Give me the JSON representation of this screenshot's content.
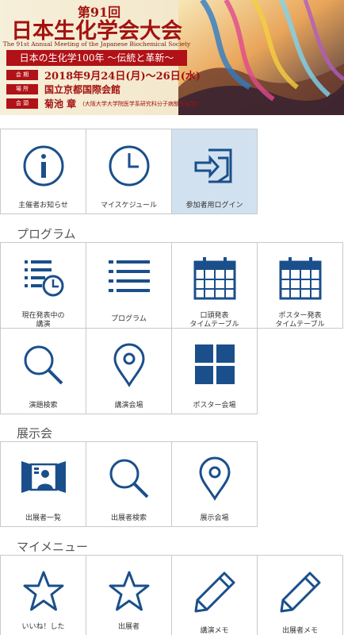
{
  "banner": {
    "edition": "第91回",
    "title": "日本生化学会大会",
    "subtitle_en": "The 91st Annual Meeting of the Japanese Biochemical Society",
    "theme": "日本の生化学100年 〜伝統と革新〜",
    "period_label": "会 期",
    "period_value": "2018年9月24日(月)〜26日(水)",
    "venue_label": "場 所",
    "venue_value": "国立京都国際会館",
    "chair_label": "会 頭",
    "chair_value": "菊池 章",
    "chair_note": "(大阪大学大学院医学系研究科分子病態生化学)"
  },
  "top_menu": [
    {
      "label": "主催者お知らせ",
      "icon": "info-icon"
    },
    {
      "label": "マイスケジュール",
      "icon": "clock-icon"
    },
    {
      "label": "参加者用ログイン",
      "icon": "login-icon"
    }
  ],
  "sections": {
    "program": "プログラム",
    "exhibition": "展示会",
    "mymenu": "マイメニュー"
  },
  "program_menu": [
    {
      "label": "現在発表中の\n講演",
      "icon": "current-list-clock-icon"
    },
    {
      "label": "プログラム",
      "icon": "list-icon"
    },
    {
      "label": "口頭発表\nタイムテーブル",
      "icon": "calendar-icon"
    },
    {
      "label": "ポスター発表\nタイムテーブル",
      "icon": "calendar-icon"
    },
    {
      "label": "演題検索",
      "icon": "search-icon"
    },
    {
      "label": "講演会場",
      "icon": "map-pin-icon"
    },
    {
      "label": "ポスター会場",
      "icon": "grid-icon"
    }
  ],
  "exhibition_menu": [
    {
      "label": "出展者一覧",
      "icon": "exhibitor-icon"
    },
    {
      "label": "出展者検索",
      "icon": "search-icon"
    },
    {
      "label": "展示会場",
      "icon": "map-pin-icon"
    }
  ],
  "mymenu_menu": [
    {
      "label": "いいね！した",
      "icon": "star-icon"
    },
    {
      "label": "出展者",
      "icon": "star-icon"
    },
    {
      "label": "講演メモ",
      "icon": "pencil-icon"
    },
    {
      "label": "出展者メモ",
      "icon": "pencil-icon"
    }
  ],
  "colors": {
    "icon_blue": "#1a4f8b",
    "active_tile": "#d2e1ef",
    "brand_red": "#a3120f"
  }
}
